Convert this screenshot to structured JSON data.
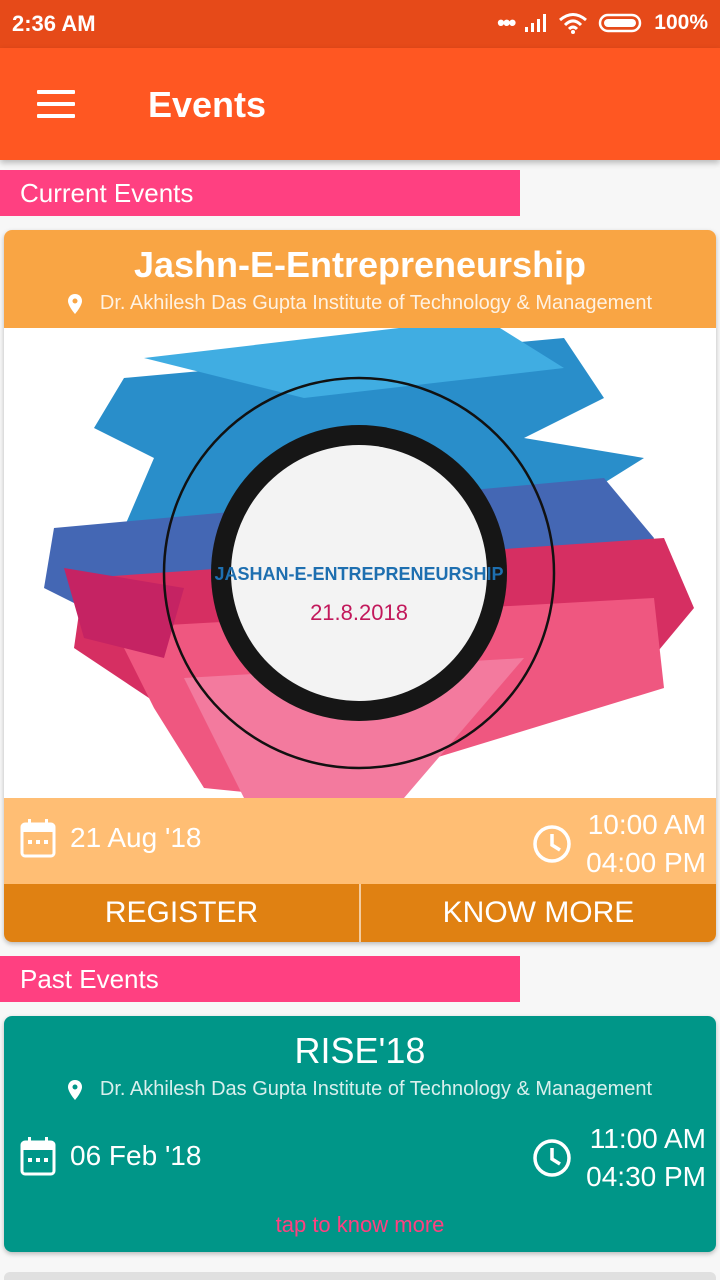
{
  "status_bar": {
    "time": "2:36 AM",
    "battery": "100%",
    "signal_dots": "•••"
  },
  "app_bar": {
    "title": "Events",
    "menu_icon": "hamburger-menu-icon"
  },
  "sections": {
    "current": "Current Events",
    "past": "Past Events"
  },
  "current_event": {
    "title": "Jashn-E-Entrepreneurship",
    "venue": "Dr. Akhilesh Das Gupta Institute of Technology & Management",
    "poster_title": "JASHAN-E-ENTREPRENEURSHIP",
    "poster_date": "21.8.2018",
    "date": "21 Aug '18",
    "start_time": "10:00 AM",
    "end_time": "04:00 PM",
    "register_label": "REGISTER",
    "know_more_label": "KNOW MORE"
  },
  "past_event": {
    "title": "RISE'18",
    "venue": "Dr. Akhilesh Das Gupta Institute of Technology & Management",
    "date": "06 Feb '18",
    "start_time": "11:00 AM",
    "end_time": "04:30 PM",
    "tap_label": "tap to know more"
  },
  "colors": {
    "status_bar": "#e64a19",
    "app_bar": "#ff5722",
    "section_header": "#ff4081",
    "current_card_header": "#f9a544",
    "current_card_actions": "#e08112",
    "past_card": "#009688",
    "tap_text": "#ff4081"
  }
}
